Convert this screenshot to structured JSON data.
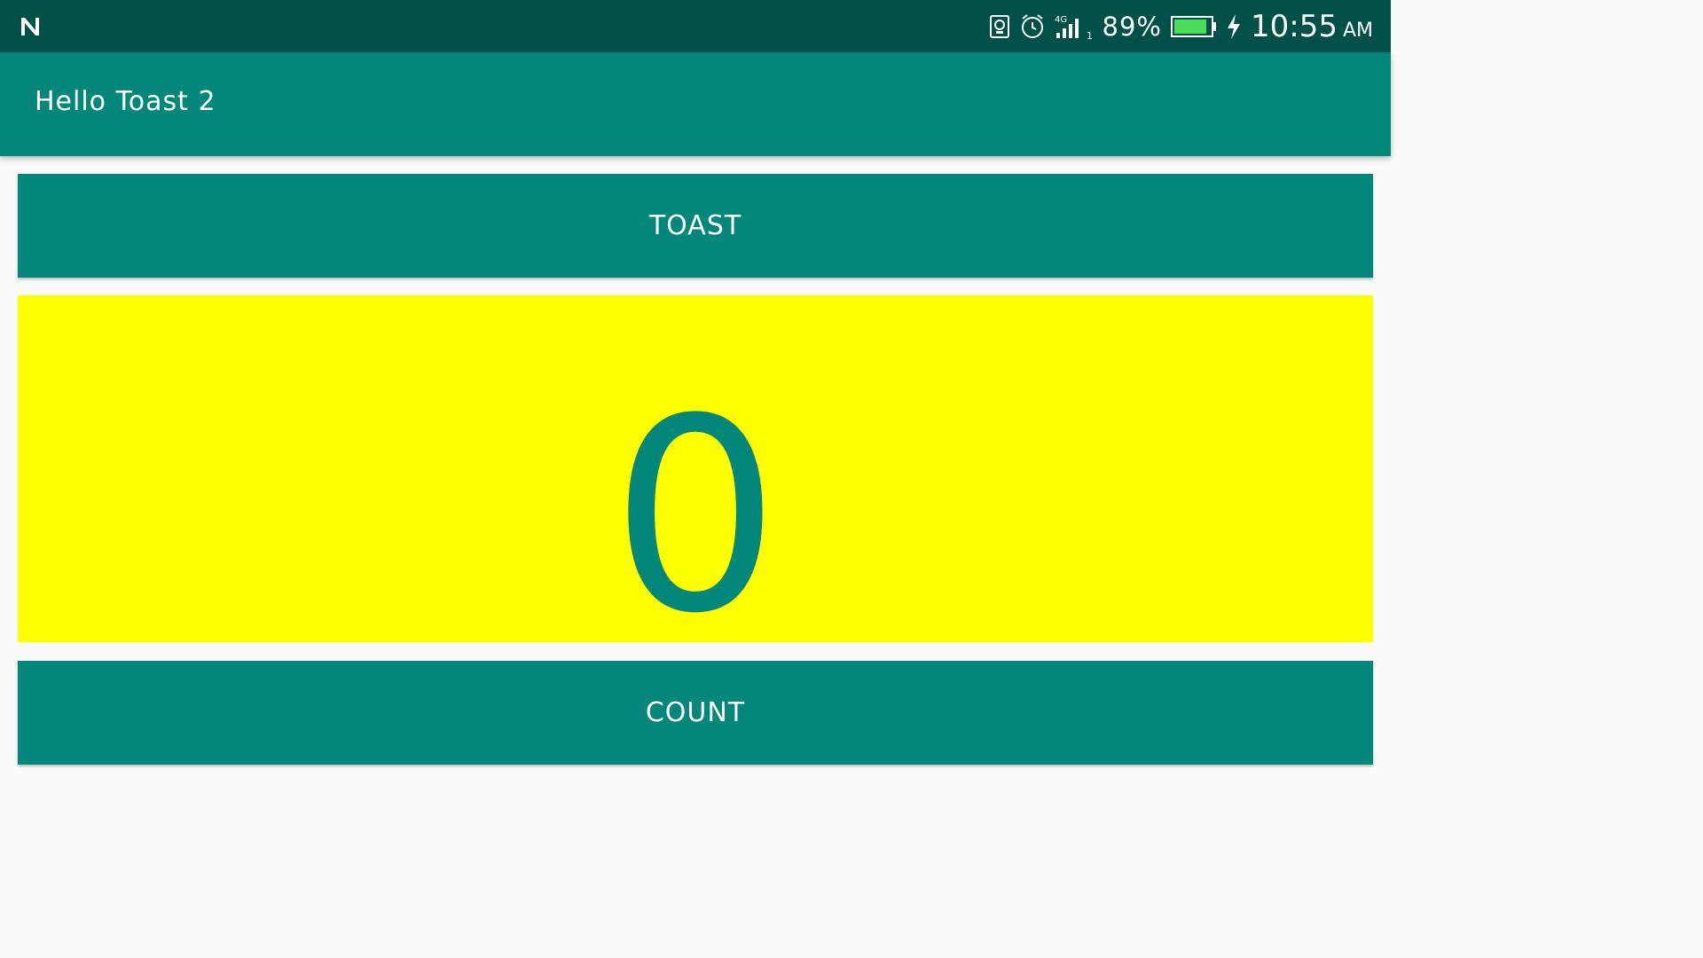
{
  "status_bar": {
    "notification_icon": "n-logo-icon",
    "icons": [
      "screen-cast-icon",
      "alarm-icon",
      "signal-4g-icon"
    ],
    "network_label": "4G",
    "sim_slot": "1",
    "battery_percent": "89%",
    "battery_level": 0.89,
    "charging_icon": "bolt-icon",
    "time": "10:55",
    "ampm": "AM"
  },
  "app_bar": {
    "title": "Hello Toast 2"
  },
  "toast_button": {
    "label": "TOAST"
  },
  "count_display": {
    "value": "0"
  },
  "count_button": {
    "label": "COUNT"
  },
  "colors": {
    "status_bar": "#00504A",
    "primary": "#02877A",
    "count_background": "#FFFF00",
    "background": "#FAFAFA"
  }
}
